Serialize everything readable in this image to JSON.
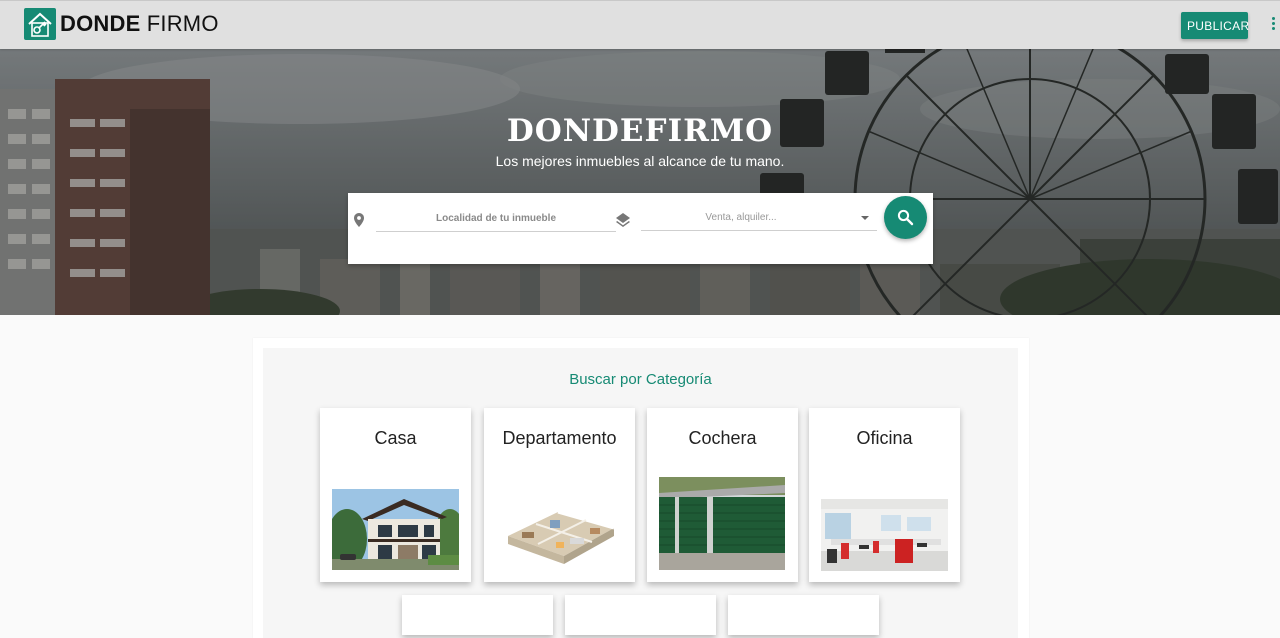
{
  "brand": {
    "bold": "DONDE",
    "light": "FIRMO",
    "icon": "key-house-icon",
    "color": "#168a74"
  },
  "header": {
    "publish_label": "PUBLICAR",
    "more_icon": "more-vertical-icon"
  },
  "hero": {
    "title": "DONDEFIRMO",
    "subtitle": "Los mejores inmuebles al alcance de tu mano."
  },
  "search": {
    "location_placeholder": "Localidad de tu inmueble",
    "location_icon": "location-pin-icon",
    "operation_icon": "layers-icon",
    "operation_placeholder": "Venta, alquiler...",
    "search_icon": "search-icon"
  },
  "categories": {
    "title": "Buscar por Categoría",
    "items": [
      {
        "label": "Casa"
      },
      {
        "label": "Departamento"
      },
      {
        "label": "Cochera"
      },
      {
        "label": "Oficina"
      }
    ]
  }
}
